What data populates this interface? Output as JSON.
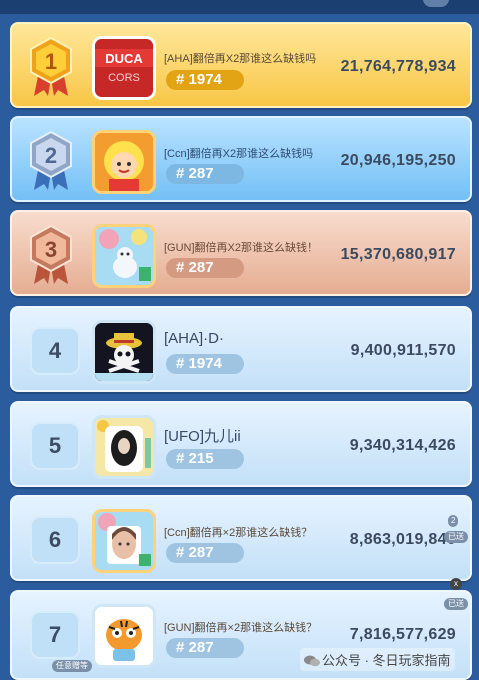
{
  "rows": [
    {
      "rank": "1",
      "name": "[AHA]翻倍再X2那谁这么缺钱吗",
      "tag": "# 1974",
      "score": "21,764,778,934"
    },
    {
      "rank": "2",
      "name": "[Ccn]翻倍再X2那谁这么缺钱吗",
      "tag": "# 287",
      "score": "20,946,195,250"
    },
    {
      "rank": "3",
      "name": "[GUN]翻倍再X2那谁这么缺钱！",
      "tag": "# 287",
      "score": "15,370,680,917"
    },
    {
      "rank": "4",
      "name": "[AHA]·D·",
      "tag": "# 1974",
      "score": "9,400,911,570"
    },
    {
      "rank": "5",
      "name": "[UFO]九儿ii",
      "tag": "# 215",
      "score": "9,340,314,426"
    },
    {
      "rank": "6",
      "name": "[Ccn]翻倍再×2那谁这么缺钱？",
      "tag": "# 287",
      "score": "8,863,019,840"
    },
    {
      "rank": "7",
      "name": "[GUN]翻倍再×2那谁这么缺钱？",
      "tag": "# 287",
      "score": "7,816,577,629"
    }
  ],
  "avatar1_text": {
    "line1": "DUCA",
    "line2": "CORS"
  },
  "badges": {
    "count": "2",
    "label6": "已送",
    "label7": "已送",
    "label7b": "任意赠等"
  },
  "close_glyph": "x",
  "watermark": "公众号 · 冬日玩家指南",
  "icons": [
    "medal-gold-icon",
    "medal-silver-icon",
    "medal-bronze-icon",
    "wechat-icon",
    "close-icon"
  ],
  "colors": {
    "gold": "#f8c646",
    "silver": "#74bff6",
    "bronze": "#e5ad92",
    "normal": "#c3e0f8",
    "text": "#3c4a60"
  }
}
